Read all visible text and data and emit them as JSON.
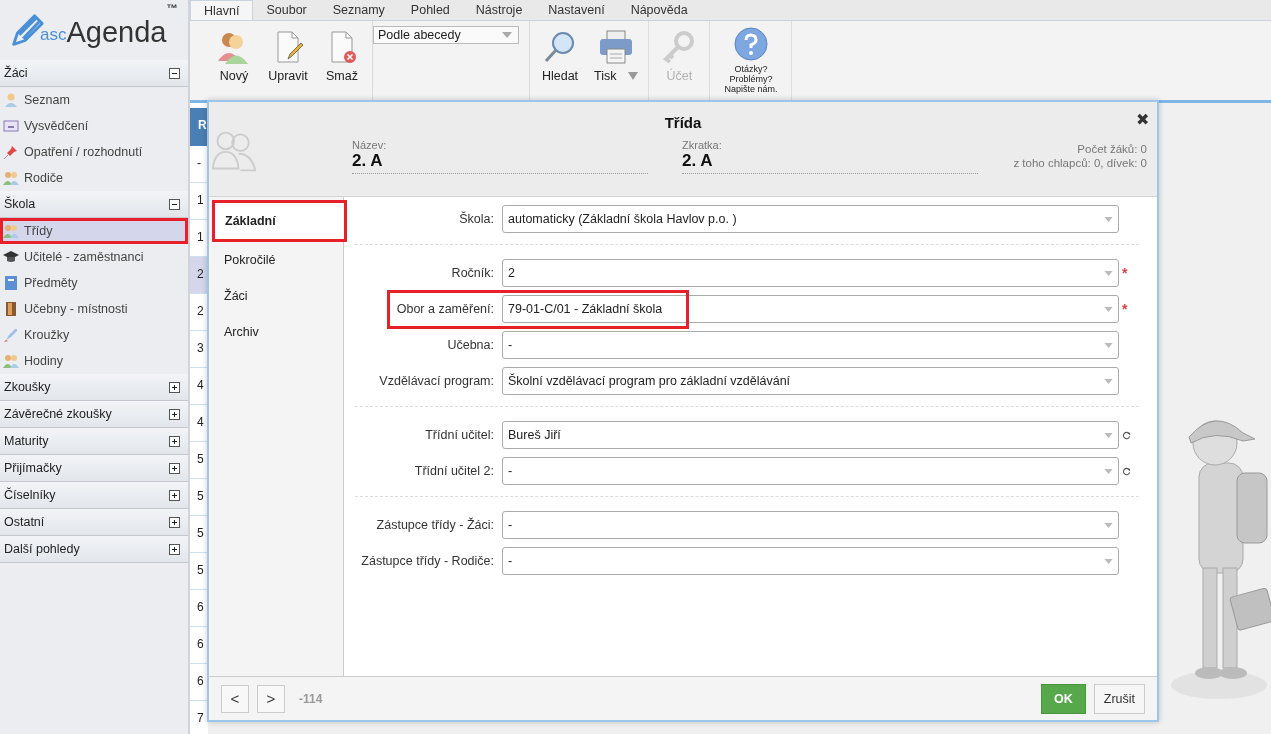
{
  "logo": {
    "prefix": "asc",
    "name": "Agenda",
    "mark": "™"
  },
  "sidebar": {
    "sections": [
      {
        "title": "Žáci",
        "expanded": true,
        "items": [
          {
            "label": "Seznam",
            "kind": "person",
            "selected": false,
            "highlighted": false
          },
          {
            "label": "Vysvědčení",
            "kind": "certificate",
            "selected": false,
            "highlighted": false
          },
          {
            "label": "Opatření / rozhodnutí",
            "kind": "pin",
            "selected": false,
            "highlighted": false
          },
          {
            "label": "Rodiče",
            "kind": "parents",
            "selected": false,
            "highlighted": false
          }
        ]
      },
      {
        "title": "Škola",
        "expanded": true,
        "items": [
          {
            "label": "Třídy",
            "kind": "class",
            "selected": true,
            "highlighted": true
          },
          {
            "label": "Učitelé - zaměstnanci",
            "kind": "teacher",
            "selected": false,
            "highlighted": false
          },
          {
            "label": "Předměty",
            "kind": "subject",
            "selected": false,
            "highlighted": false
          },
          {
            "label": "Učebny - místnosti",
            "kind": "room",
            "selected": false,
            "highlighted": false
          },
          {
            "label": "Kroužky",
            "kind": "club",
            "selected": false,
            "highlighted": false
          },
          {
            "label": "Hodiny",
            "kind": "hours",
            "selected": false,
            "highlighted": false
          }
        ]
      },
      {
        "title": "Zkoušky",
        "expanded": false
      },
      {
        "title": "Závěrečné zkoušky",
        "expanded": false
      },
      {
        "title": "Maturity",
        "expanded": false
      },
      {
        "title": "Přijímačky",
        "expanded": false
      },
      {
        "title": "Číselníky",
        "expanded": false
      },
      {
        "title": "Ostatní",
        "expanded": false
      },
      {
        "title": "Další pohledy",
        "expanded": false
      }
    ]
  },
  "ribbon": {
    "tabs": [
      {
        "label": "Hlavní",
        "selected": true
      },
      {
        "label": "Soubor",
        "selected": false
      },
      {
        "label": "Seznamy",
        "selected": false
      },
      {
        "label": "Pohled",
        "selected": false
      },
      {
        "label": "Nástroje",
        "selected": false
      },
      {
        "label": "Nastavení",
        "selected": false
      },
      {
        "label": "Nápověda",
        "selected": false
      }
    ],
    "groups": [
      {
        "kind": "buttons",
        "buttons": [
          {
            "label": "Nový",
            "kind": "new",
            "disabled": false
          },
          {
            "label": "Upravit",
            "kind": "edit",
            "disabled": false
          },
          {
            "label": "Smaž",
            "kind": "delete",
            "disabled": false
          }
        ]
      },
      {
        "kind": "select",
        "value": "Podle abecedy"
      },
      {
        "kind": "buttons",
        "buttons": [
          {
            "label": "Hledat",
            "kind": "search",
            "disabled": false
          },
          {
            "label": "Tisk",
            "kind": "print",
            "disabled": false,
            "dropdown": true
          }
        ]
      },
      {
        "kind": "buttons",
        "buttons": [
          {
            "label": "Účet",
            "kind": "account",
            "disabled": true
          }
        ]
      },
      {
        "kind": "help",
        "lines": [
          "Otázky?",
          "Problémy?",
          "Napište nám."
        ]
      }
    ]
  },
  "background_table": {
    "header": "R",
    "rows": [
      {
        "text": "-",
        "selected": false
      },
      {
        "text": "1",
        "selected": false
      },
      {
        "text": "1",
        "selected": false
      },
      {
        "text": "2",
        "selected": true
      },
      {
        "text": "2",
        "selected": false
      },
      {
        "text": "3",
        "selected": false
      },
      {
        "text": "4",
        "selected": false
      },
      {
        "text": "4",
        "selected": false
      },
      {
        "text": "5",
        "selected": false
      },
      {
        "text": "5",
        "selected": false
      },
      {
        "text": "5",
        "selected": false
      },
      {
        "text": "5",
        "selected": false
      },
      {
        "text": "6",
        "selected": false
      },
      {
        "text": "6",
        "selected": false
      },
      {
        "text": "6",
        "selected": false
      },
      {
        "text": "7",
        "selected": false
      }
    ]
  },
  "dialog": {
    "title": "Třída",
    "close": "✖",
    "fields": [
      {
        "label": "Název:",
        "value": "2. A"
      },
      {
        "label": "Zkratka:",
        "value": "2. A"
      }
    ],
    "stats": [
      "Počet žáků: 0",
      "z toho chlapců: 0, dívek: 0"
    ],
    "tabs": [
      {
        "label": "Základní",
        "selected": true,
        "highlighted": true
      },
      {
        "label": "Pokročilé",
        "selected": false,
        "highlighted": false
      },
      {
        "label": "Žáci",
        "selected": false,
        "highlighted": false
      },
      {
        "label": "Archiv",
        "selected": false,
        "highlighted": false
      }
    ],
    "form_groups": [
      {
        "rows": [
          {
            "label": "Škola:",
            "value": "automaticky (Základní škola Havlov p.o. )"
          }
        ]
      },
      {
        "rows": [
          {
            "label": "Ročník:",
            "value": "2",
            "required_mark": "*"
          },
          {
            "label": "Obor a zaměření:",
            "value": "79-01-C/01 - Základní škola",
            "required_mark": "*",
            "highlighted": true
          },
          {
            "label": "Učebna:",
            "value": "-"
          },
          {
            "label": "Vzdělávací program:",
            "value": "Školní vzdělávací program pro základní vzdělávání"
          }
        ]
      },
      {
        "rows": [
          {
            "label": "Třídní učitel:",
            "value": "Bureš Jiří",
            "refresh": true
          },
          {
            "label": "Třídní učitel 2:",
            "value": "-",
            "refresh": true
          }
        ]
      },
      {
        "rows": [
          {
            "label": "Zástupce třídy - Žáci:",
            "value": "-"
          },
          {
            "label": "Zástupce třídy - Rodiče:",
            "value": "-"
          }
        ]
      }
    ],
    "footer": {
      "prev": "<",
      "next": ">",
      "record": "-114",
      "ok": "OK",
      "cancel": "Zrušit"
    }
  }
}
